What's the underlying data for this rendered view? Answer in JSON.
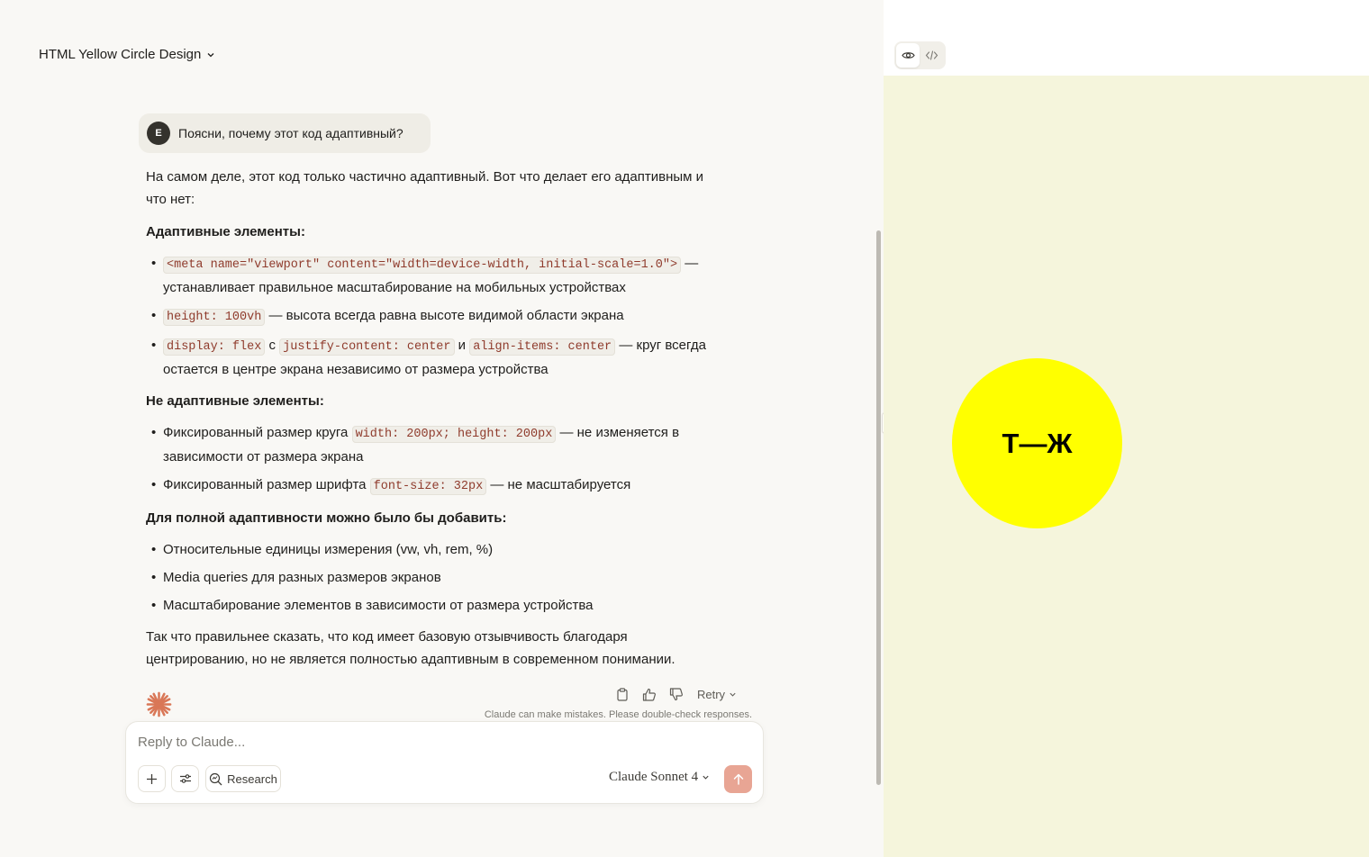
{
  "chat": {
    "title": "HTML Yellow Circle Design",
    "user_message": {
      "avatar_initial": "E",
      "text": "Поясни, почему этот код адаптивный?"
    },
    "response": {
      "intro": "На самом деле, этот код только частично адаптивный. Вот что делает его адаптивным и что нет:",
      "adaptive_heading": "Адаптивные элементы:",
      "adaptive_items": [
        {
          "code": "<meta name=\"viewport\" content=\"width=device-width, initial-scale=1.0\">",
          "text": " — устанавливает правильное масштабирование на мобильных устройствах"
        },
        {
          "code": "height: 100vh",
          "text": " — высота всегда равна высоте видимой области экрана"
        },
        {
          "code1": "display: flex",
          "sep1": " с ",
          "code2": "justify-content: center",
          "sep2": " и ",
          "code3": "align-items: center",
          "text": " — круг всегда остается в центре экрана независимо от размера устройства"
        }
      ],
      "non_adaptive_heading": "Не адаптивные элементы:",
      "non_adaptive_items": [
        {
          "prefix": "Фиксированный размер круга ",
          "code": "width: 200px; height: 200px",
          "text": " — не изменяется в зависимости от размера экрана"
        },
        {
          "prefix": "Фиксированный размер шрифта ",
          "code": "font-size: 32px",
          "text": " — не масштабируется"
        }
      ],
      "full_heading": "Для полной адаптивности можно было бы добавить:",
      "full_items": [
        "Относительные единицы измерения (vw, vh, rem, %)",
        "Media queries для разных размеров экранов",
        "Масштабирование элементов в зависимости от размера устройства"
      ],
      "conclusion": "Так что правильнее сказать, что код имеет базовую отзывчивость благодаря центрированию, но не является полностью адаптивным в современном понимании."
    },
    "actions": {
      "retry_label": "Retry",
      "disclaimer": "Claude can make mistakes. Please double-check responses."
    },
    "composer": {
      "placeholder": "Reply to Claude...",
      "research_label": "Research",
      "model_label": "Claude Sonnet 4"
    }
  },
  "preview": {
    "circle_text": "Т—Ж",
    "circle_color": "#ffff00",
    "background_color": "#f5f5dc"
  },
  "colors": {
    "accent": "#d97757",
    "send_button": "#e8a594",
    "code_text": "#8f3b2c"
  }
}
